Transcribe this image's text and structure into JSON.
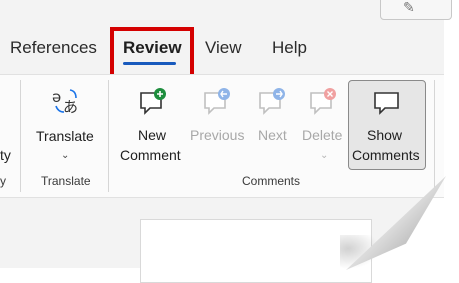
{
  "tabs": [
    {
      "label": "References"
    },
    {
      "label": "Review"
    },
    {
      "label": "View"
    },
    {
      "label": "Help"
    }
  ],
  "active_tab": "Review",
  "left_fragments": {
    "top": "ty",
    "bottom": "y"
  },
  "groups": {
    "translate": {
      "button_label": "Translate",
      "group_label": "Translate",
      "icon": "translate-icon"
    },
    "comments": {
      "group_label": "Comments",
      "buttons": [
        {
          "line1": "New",
          "line2": "Comment",
          "icon": "new-comment-icon",
          "enabled": true
        },
        {
          "line1": "Previous",
          "icon": "previous-comment-icon",
          "enabled": false
        },
        {
          "line1": "Next",
          "icon": "next-comment-icon",
          "enabled": false
        },
        {
          "line1": "Delete",
          "icon": "delete-comment-icon",
          "enabled": false
        },
        {
          "line1": "Show",
          "line2": "Comments",
          "icon": "show-comments-icon",
          "enabled": true
        }
      ]
    }
  },
  "colors": {
    "accent_underline": "#185abd",
    "highlight_box": "#d40000",
    "new_badge": "#1e8e3e",
    "disabled_badge_blue": "#8fb4e8",
    "disabled_badge_red": "#f0a0a0"
  }
}
